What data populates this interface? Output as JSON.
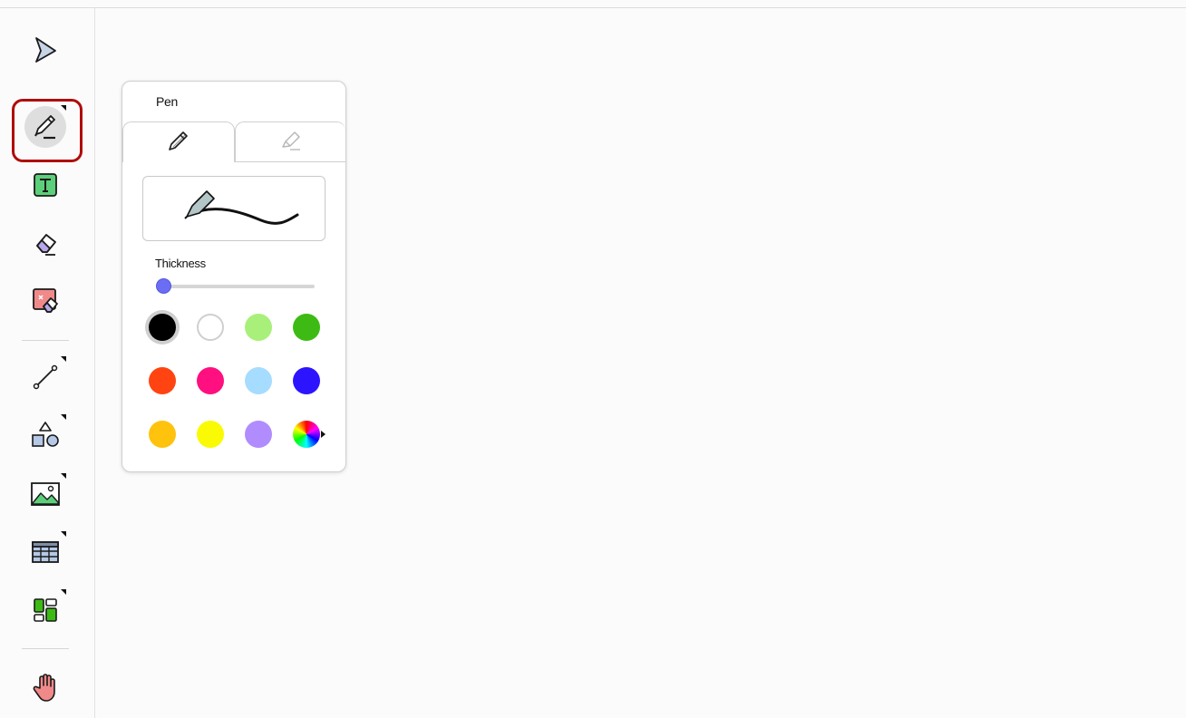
{
  "toolbar": {
    "tools": [
      {
        "name": "select",
        "icon": "select-arrow-icon"
      },
      {
        "name": "pen",
        "icon": "pen-icon",
        "selected": true
      },
      {
        "name": "text",
        "icon": "text-icon"
      },
      {
        "name": "eraser",
        "icon": "eraser-icon"
      },
      {
        "name": "clear",
        "icon": "clear-shapes-icon"
      },
      {
        "name": "line",
        "icon": "line-icon"
      },
      {
        "name": "shapes",
        "icon": "shapes-icon"
      },
      {
        "name": "image",
        "icon": "image-icon"
      },
      {
        "name": "table",
        "icon": "table-icon"
      },
      {
        "name": "widgets",
        "icon": "widgets-icon"
      },
      {
        "name": "pan",
        "icon": "hand-icon"
      }
    ]
  },
  "pen_panel": {
    "title": "Pen",
    "tabs": [
      {
        "name": "pen",
        "icon": "pen-tab-icon",
        "active": true
      },
      {
        "name": "highlighter",
        "icon": "highlighter-tab-icon",
        "active": false
      }
    ],
    "thickness_label": "Thickness",
    "thickness_value": 0.05,
    "colors": [
      "#000000",
      "#ffffff",
      "#a8f07a",
      "#3dbb14",
      "#ff4411",
      "#ff0f80",
      "#a6dcff",
      "#2c14ff",
      "#ffc20d",
      "#fafa05",
      "#b08cff",
      "spectrum"
    ],
    "selected_color": "#000000"
  }
}
